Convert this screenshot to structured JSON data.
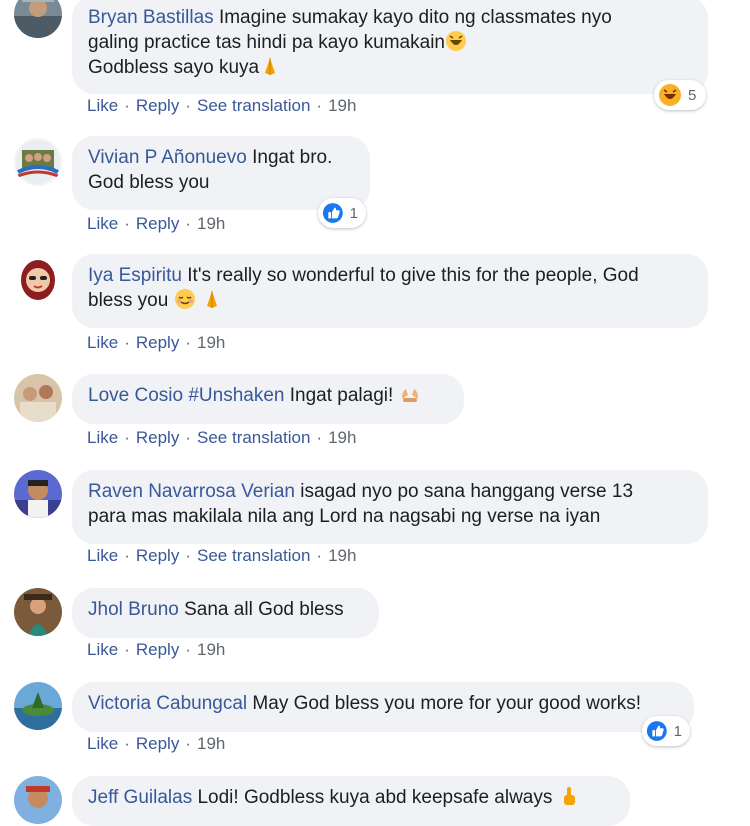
{
  "comments": [
    {
      "author": "Bryan Bastillas",
      "line1": " Imagine sumakay kayo dito ng classmates nyo",
      "line2": "galing practice tas hindi pa kayo kumakain",
      "line3": "Godbless sayo kuya",
      "emoji_names": [
        "laughing-emoji",
        "folded-hands-emoji"
      ],
      "actions": {
        "like": "Like",
        "reply": "Reply",
        "translate": "See translation",
        "time": "19h"
      },
      "reaction": {
        "type": "haha",
        "count": "5"
      }
    },
    {
      "author": "Vivian P Añonuevo",
      "line1": " Ingat bro.",
      "line2": "God bless you",
      "actions": {
        "like": "Like",
        "reply": "Reply",
        "time": "19h"
      },
      "reaction": {
        "type": "like",
        "count": "1"
      }
    },
    {
      "author": "Iya Espiritu",
      "line1": " It's really so wonderful to give this for the people, God",
      "line2": "bless you",
      "emoji_names": [
        "relieved-face-emoji",
        "folded-hands-emoji"
      ],
      "actions": {
        "like": "Like",
        "reply": "Reply",
        "time": "19h"
      }
    },
    {
      "author": "Love Cosio",
      "tag": " #Unshaken",
      "line1": " Ingat palagi!",
      "emoji_names": [
        "raised-hands-emoji"
      ],
      "actions": {
        "like": "Like",
        "reply": "Reply",
        "translate": "See translation",
        "time": "19h"
      }
    },
    {
      "author": "Raven Navarrosa Verian",
      "line1": " isagad nyo po sana hanggang verse 13",
      "line2": "para mas makilala nila ang Lord na nagsabi ng verse na iyan",
      "actions": {
        "like": "Like",
        "reply": "Reply",
        "translate": "See translation",
        "time": "19h"
      }
    },
    {
      "author": "Jhol Bruno",
      "line1": " Sana all God bless",
      "actions": {
        "like": "Like",
        "reply": "Reply",
        "time": "19h"
      }
    },
    {
      "author": "Victoria Cabungcal",
      "line1": " May God bless you more for your good works!",
      "actions": {
        "like": "Like",
        "reply": "Reply",
        "time": "19h"
      },
      "reaction": {
        "type": "like",
        "count": "1"
      }
    },
    {
      "author": "Jeff Guilalas",
      "line1": " Lodi! Godbless kuya abd keepsafe always",
      "emoji_names": [
        "pointing-up-emoji"
      ]
    }
  ],
  "colors": {
    "link": "#385898",
    "bubble": "#f0f2f5",
    "meta": "#606770",
    "like_blue": "#1877f2"
  }
}
